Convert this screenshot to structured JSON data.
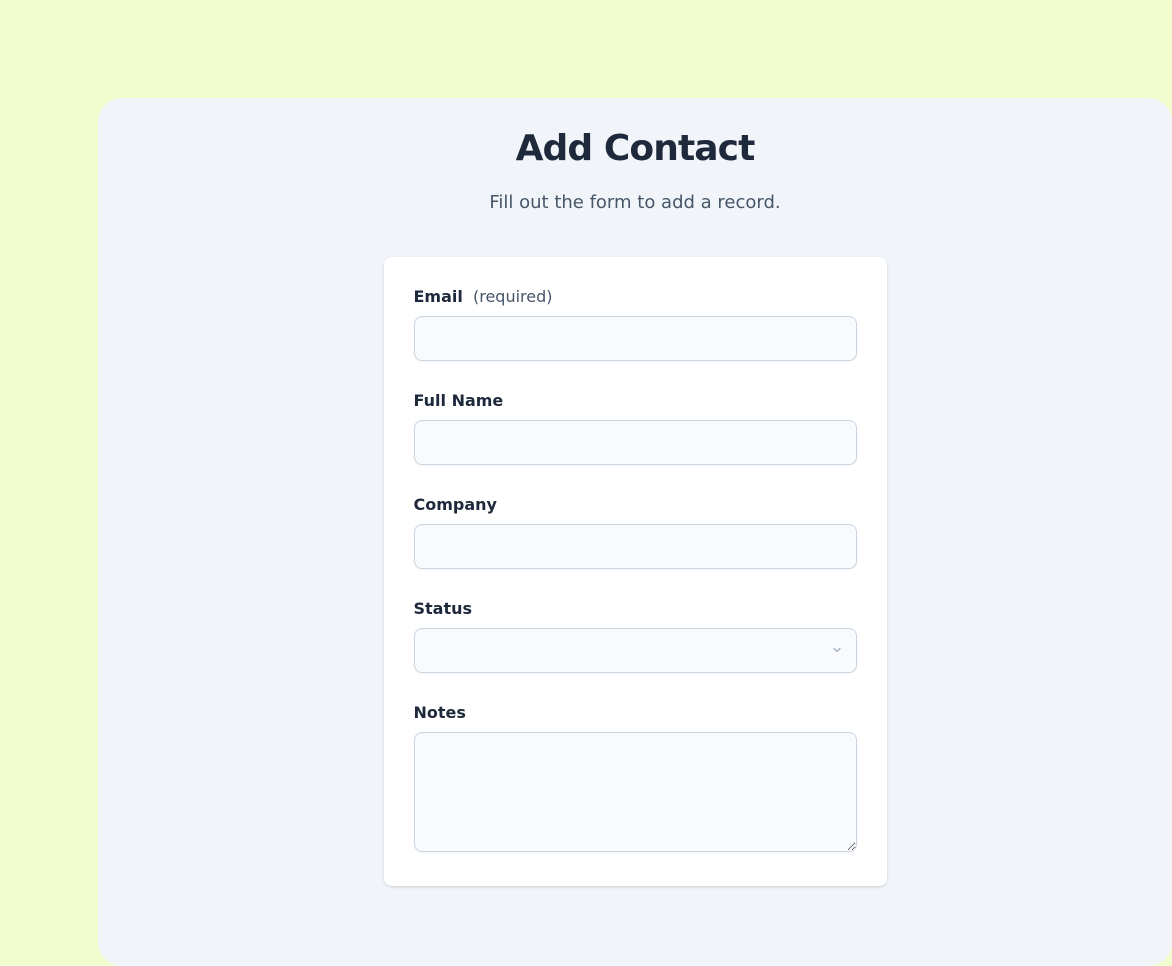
{
  "header": {
    "title": "Add Contact",
    "subtitle": "Fill out the form to add a record."
  },
  "form": {
    "fields": {
      "email": {
        "label": "Email",
        "required_text": "(required)",
        "value": ""
      },
      "full_name": {
        "label": "Full Name",
        "value": ""
      },
      "company": {
        "label": "Company",
        "value": ""
      },
      "status": {
        "label": "Status",
        "value": ""
      },
      "notes": {
        "label": "Notes",
        "value": ""
      }
    }
  }
}
